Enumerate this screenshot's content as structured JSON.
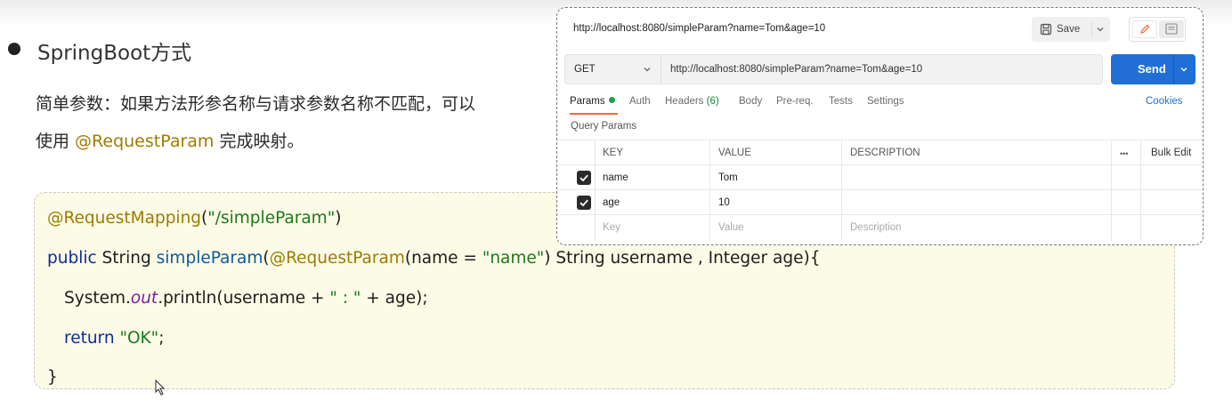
{
  "slide": {
    "heading": "SpringBoot方式",
    "para_line1": "简单参数：如果方法形参名称与请求参数名称不匹配，可以",
    "para_line2_pre": "使用 ",
    "para_line2_annotation": "@RequestParam",
    "para_line2_post": " 完成映射。"
  },
  "code": {
    "line1": {
      "annotation": "@RequestMapping",
      "open": "(",
      "string": "\"/simpleParam\"",
      "close": ")"
    },
    "line2": {
      "keyword": "public",
      "type": " String ",
      "method": "simpleParam",
      "open": "(",
      "annotation": "@RequestParam",
      "args_pre": "(name = ",
      "string": "\"name\"",
      "args_post": ") String username , Integer age){"
    },
    "line3": {
      "pre": "System.",
      "static_field": "out",
      "post": ".println(username + ",
      "string": "\" : \"",
      "tail": " + age);"
    },
    "line4": {
      "keyword": "return",
      "space": " ",
      "string": "\"OK\"",
      "tail": ";"
    },
    "line5": "}"
  },
  "postman": {
    "tab_title": "http://localhost:8080/simpleParam?name=Tom&age=10",
    "save_label": "Save",
    "method": "GET",
    "url": "http://localhost:8080/simpleParam?name=Tom&age=10",
    "send_label": "Send",
    "tabs": [
      {
        "label": "Params",
        "active": true,
        "dot": true
      },
      {
        "label": "Auth"
      },
      {
        "label": "Headers",
        "count": "(6)"
      },
      {
        "label": "Body"
      },
      {
        "label": "Pre-req."
      },
      {
        "label": "Tests"
      },
      {
        "label": "Settings"
      }
    ],
    "cookies_label": "Cookies",
    "section_label": "Query Params",
    "table": {
      "headers": {
        "key": "KEY",
        "value": "VALUE",
        "description": "DESCRIPTION",
        "more": "•••",
        "bulk_edit": "Bulk Edit"
      },
      "rows": [
        {
          "checked": true,
          "key": "name",
          "value": "Tom",
          "description": ""
        },
        {
          "checked": true,
          "key": "age",
          "value": "10",
          "description": ""
        }
      ],
      "placeholders": {
        "key": "Key",
        "value": "Value",
        "description": "Description"
      }
    }
  },
  "colors": {
    "send_button": "#1f6fd6",
    "active_tab_underline": "#f26b3a",
    "code_background": "#fcfbe6",
    "annotation": "#9c7b00",
    "string": "#1a7a1a"
  }
}
